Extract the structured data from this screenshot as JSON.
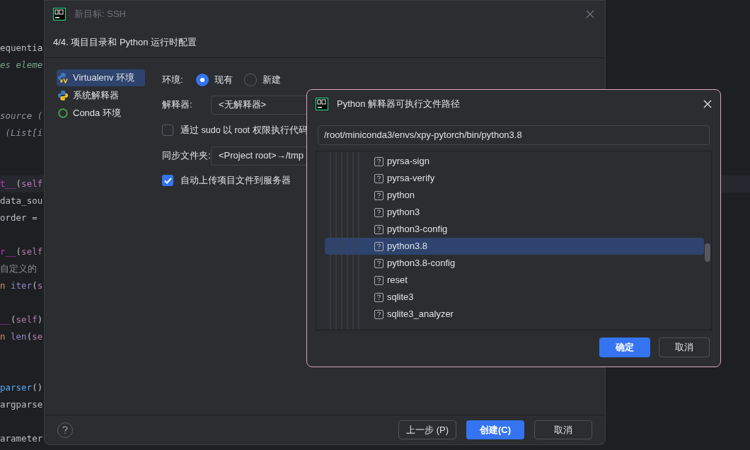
{
  "editor": {
    "lines": [
      {
        "kind": "code",
        "segments": [
          {
            "kind": "plain",
            "text": "equentia"
          }
        ]
      },
      {
        "kind": "code",
        "segments": [
          {
            "kind": "doc",
            "text": "es eleme"
          }
        ]
      },
      {
        "kind": "after_two_blanks",
        "segments": [
          {
            "kind": "comment",
            "text": "source ("
          }
        ]
      },
      {
        "kind": "code",
        "segments": [
          {
            "kind": "comment",
            "text": " (List[i"
          }
        ]
      },
      {
        "kind": "after_two_blanks",
        "current": true,
        "segments": [
          {
            "kind": "magic",
            "text": "t__"
          },
          {
            "kind": "plain",
            "text": "("
          },
          {
            "kind": "self",
            "text": "self"
          }
        ]
      },
      {
        "kind": "code",
        "segments": [
          {
            "kind": "plain",
            "text": "data_sou"
          }
        ]
      },
      {
        "kind": "code",
        "segments": [
          {
            "kind": "plain",
            "text": "order ="
          }
        ]
      },
      {
        "kind": "after_blank",
        "segments": [
          {
            "kind": "magic",
            "text": "r__"
          },
          {
            "kind": "plain",
            "text": "("
          },
          {
            "kind": "self",
            "text": "self"
          }
        ]
      },
      {
        "kind": "code",
        "segments": [
          {
            "kind": "cjk",
            "text": "自定义的"
          }
        ]
      },
      {
        "kind": "code",
        "segments": [
          {
            "kind": "keyword",
            "text": "n "
          },
          {
            "kind": "builtin",
            "text": "iter"
          },
          {
            "kind": "plain",
            "text": "("
          },
          {
            "kind": "self",
            "text": "s"
          }
        ]
      },
      {
        "kind": "after_blank",
        "segments": [
          {
            "kind": "magic",
            "text": "__"
          },
          {
            "kind": "plain",
            "text": "("
          },
          {
            "kind": "self",
            "text": "self"
          },
          {
            "kind": "plain",
            "text": ")"
          }
        ]
      },
      {
        "kind": "code",
        "segments": [
          {
            "kind": "keyword",
            "text": "n "
          },
          {
            "kind": "builtin",
            "text": "len"
          },
          {
            "kind": "plain",
            "text": "("
          },
          {
            "kind": "self",
            "text": "se"
          }
        ]
      },
      {
        "kind": "after_two_blanks",
        "segments": [
          {
            "kind": "func",
            "text": "parser"
          },
          {
            "kind": "plain",
            "text": "()"
          }
        ]
      },
      {
        "kind": "code",
        "segments": [
          {
            "kind": "plain",
            "text": "argparse"
          }
        ]
      },
      {
        "kind": "after_blank",
        "segments": [
          {
            "kind": "plain",
            "text": "arameter"
          }
        ]
      }
    ]
  },
  "main_dialog": {
    "title": "新目标: SSH",
    "active": false,
    "subtitle": "4/4. 项目目录和 Python 运行时配置",
    "sidebar": [
      {
        "label": "Virtualenv 环境",
        "selected": true
      },
      {
        "label": "系统解释器",
        "selected": false
      },
      {
        "label": "Conda 环境",
        "selected": false
      }
    ],
    "environment": {
      "label": "环境:",
      "options": [
        {
          "label": "现有",
          "selected": true
        },
        {
          "label": "新建",
          "selected": false
        }
      ]
    },
    "interpreter": {
      "label": "解释器:",
      "value": "<无解释器>"
    },
    "sudo": {
      "label": "通过 sudo 以 root 权限执行代码",
      "checked": false
    },
    "sync_folder": {
      "label": "同步文件夹:",
      "value": "<Project root>→/tmp"
    },
    "auto_upload": {
      "label": "自动上传项目文件到服务器",
      "checked": true
    },
    "buttons": [
      {
        "label": "上一步 (P)",
        "primary": false
      },
      {
        "label": "创建(C)",
        "primary": true
      },
      {
        "label": "取消",
        "primary": false
      }
    ]
  },
  "file_dialog": {
    "title": "Python 解释器可执行文件路径",
    "path": "/root/miniconda3/envs/xpy-pytorch/bin/python3.8",
    "entries": [
      {
        "name": "pyrsa-sign",
        "selected": false
      },
      {
        "name": "pyrsa-verify",
        "selected": false
      },
      {
        "name": "python",
        "selected": false
      },
      {
        "name": "python3",
        "selected": false
      },
      {
        "name": "python3-config",
        "selected": false
      },
      {
        "name": "python3.8",
        "selected": true
      },
      {
        "name": "python3.8-config",
        "selected": false
      },
      {
        "name": "reset",
        "selected": false
      },
      {
        "name": "sqlite3",
        "selected": false
      },
      {
        "name": "sqlite3_analyzer",
        "selected": false
      }
    ],
    "buttons": [
      {
        "label": "确定",
        "primary": true
      },
      {
        "label": "取消",
        "primary": false
      }
    ]
  }
}
